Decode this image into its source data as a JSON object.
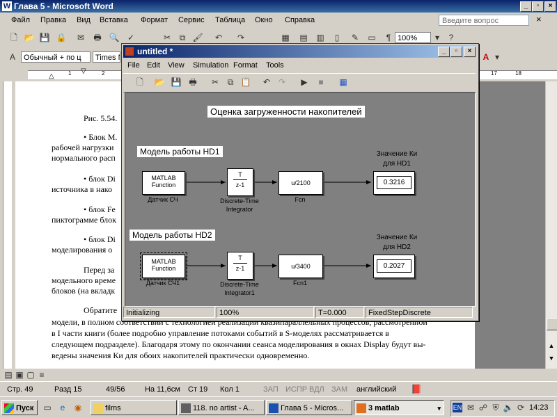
{
  "word": {
    "title": "Глава 5 - Microsoft Word",
    "menu": [
      "Файл",
      "Правка",
      "Вид",
      "Вставка",
      "Формат",
      "Сервис",
      "Таблица",
      "Окно",
      "Справка"
    ],
    "help_placeholder": "Введите вопрос",
    "zoom": "100%",
    "style_combo": "Обычный + по ц",
    "font_combo": "Times Ne",
    "ruler_numbers": [
      "1",
      "2",
      "17",
      "18"
    ],
    "doc_lines": [
      "Рис. 5.54.",
      "• Блок M.",
      "рабочей нагрузки",
      "нормального расп",
      "• блок Di",
      "источника в нако",
      "• блок Fe",
      "пиктограмме блок",
      "• блок Di",
      "моделирования о",
      "Перед за",
      "модельного време",
      "блоков (на вкладк",
      "Обратите",
      "модели, в полном соответствии с технологией реализации квазипараллельных процессов, рассмотренной",
      "в I части книги (более подробно управление потоками событий в S-моделях рассматривается в",
      "следующем подразделе). Благодаря этому по окончании сеанса моделирования в окнах Display будут вы-",
      "ведены значения Ки для обоих накопителей практически одновременно."
    ],
    "status": {
      "page": "Стр. 49",
      "section": "Разд 15",
      "pages": "49/56",
      "position": "На 11,6см",
      "line": "Ст 19",
      "col": "Кол 1",
      "rec": "ЗАП",
      "trk": "ИСПР",
      "ext": "ВДЛ",
      "ovr": "ЗАМ",
      "lang": "английский"
    }
  },
  "simulink": {
    "title": "untitled *",
    "menu": [
      "File",
      "Edit",
      "View",
      "Simulation",
      "Format",
      "Tools"
    ],
    "diagram_title": "Оценка загруженности накопителей",
    "hd1": {
      "model_label": "Модель работы HD1",
      "source_line1": "MATLAB",
      "source_line2": "Function",
      "source_label": "Датчик СЧ",
      "integrator_top": "T",
      "integrator_bottom": "z-1",
      "integrator_label1": "Discrete-Time",
      "integrator_label2": "Integrator",
      "fcn_expr": "u/2100",
      "fcn_label": "Fcn",
      "display_title1": "Значение Ки",
      "display_title2": "для HD1",
      "display_value": "0.3216"
    },
    "hd2": {
      "model_label": "Модель работы HD2",
      "source_line1": "MATLAB",
      "source_line2": "Function",
      "source_label": "Датчик СЧ1",
      "integrator_top": "T",
      "integrator_bottom": "z-1",
      "integrator_label1": "Discrete-Time",
      "integrator_label2": "Integrator1",
      "fcn_expr": "u/3400",
      "fcn_label": "Fcn1",
      "display_title1": "Значение Ки",
      "display_title2": "для HD2",
      "display_value": "0.2027"
    },
    "status": {
      "state": "Initializing",
      "zoom": "100%",
      "time": "T=0.000",
      "solver": "FixedStepDiscrete"
    }
  },
  "taskbar": {
    "start": "Пуск",
    "tasks": [
      "films",
      "118. no artist - A...",
      "Глава 5 - Micros...",
      "3 matlab"
    ],
    "lang": "EN",
    "clock": "14:23"
  },
  "colors": {
    "title_blue": "#0a246a",
    "face": "#d4d0c8",
    "canvas": "#808080"
  }
}
